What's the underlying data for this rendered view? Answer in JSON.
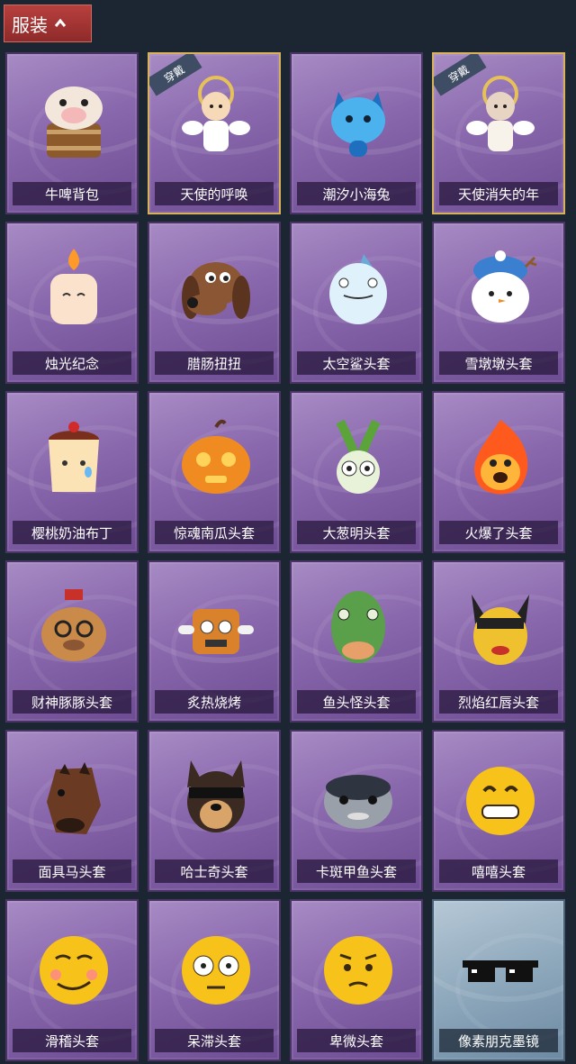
{
  "header": {
    "title": "服装",
    "toggle_icon": "chevron-up-icon"
  },
  "equipped_badge": "穿戴",
  "items": [
    {
      "name": "牛啤背包",
      "art": "cow-barrel",
      "equipped": false,
      "theme": "purple",
      "colors": [
        "#f3e7dc",
        "#8c5a2b"
      ]
    },
    {
      "name": "天使的呼唤",
      "art": "angel-boy",
      "equipped": true,
      "theme": "purple",
      "colors": [
        "#f6d9b6",
        "#e6c15a"
      ]
    },
    {
      "name": "潮汐小海兔",
      "art": "blue-rabbit",
      "equipped": false,
      "theme": "purple",
      "colors": [
        "#4cb2ee",
        "#1f6fbf"
      ]
    },
    {
      "name": "天使消失的年",
      "art": "angel-girl",
      "equipped": true,
      "theme": "purple",
      "colors": [
        "#e8d4c2",
        "#f7f2ea"
      ]
    },
    {
      "name": "烛光纪念",
      "art": "candle",
      "equipped": false,
      "theme": "purple",
      "colors": [
        "#fbe2cc",
        "#ff9a2a"
      ]
    },
    {
      "name": "腊肠扭扭",
      "art": "dog-brown",
      "equipped": false,
      "theme": "purple",
      "colors": [
        "#8a5634",
        "#5b3420"
      ]
    },
    {
      "name": "太空鲨头套",
      "art": "shark",
      "equipped": false,
      "theme": "purple",
      "colors": [
        "#dff1fb",
        "#6aa9d8"
      ]
    },
    {
      "name": "雪墩墩头套",
      "art": "snowman",
      "equipped": false,
      "theme": "purple",
      "colors": [
        "#ffffff",
        "#3a7fd0"
      ]
    },
    {
      "name": "樱桃奶油布丁",
      "art": "pudding",
      "equipped": false,
      "theme": "purple",
      "colors": [
        "#fbe3b5",
        "#7a2e1c"
      ]
    },
    {
      "name": "惊魂南瓜头套",
      "art": "pumpkin",
      "equipped": false,
      "theme": "purple",
      "colors": [
        "#f08b22",
        "#ffd35a"
      ]
    },
    {
      "name": "大葱明头套",
      "art": "scallion",
      "equipped": false,
      "theme": "purple",
      "colors": [
        "#e8f2d8",
        "#5aa43a"
      ]
    },
    {
      "name": "火爆了头套",
      "art": "fire",
      "equipped": false,
      "theme": "purple",
      "colors": [
        "#ff5a1e",
        "#ffb43a"
      ]
    },
    {
      "name": "财神豚豚头套",
      "art": "capybara",
      "equipped": false,
      "theme": "purple",
      "colors": [
        "#c98a4a",
        "#c8302a"
      ]
    },
    {
      "name": "炙热烧烤",
      "art": "bbq",
      "equipped": false,
      "theme": "purple",
      "colors": [
        "#d9822b",
        "#f2f2f2"
      ]
    },
    {
      "name": "鱼头怪头套",
      "art": "fish-man",
      "equipped": false,
      "theme": "purple",
      "colors": [
        "#5aa04a",
        "#e7a06a"
      ]
    },
    {
      "name": "烈焰红唇头套",
      "art": "yellow-mouse",
      "equipped": false,
      "theme": "purple",
      "colors": [
        "#f0c12e",
        "#222222"
      ]
    },
    {
      "name": "面具马头套",
      "art": "horse",
      "equipped": false,
      "theme": "purple",
      "colors": [
        "#6b3a22",
        "#2a1a12"
      ]
    },
    {
      "name": "哈士奇头套",
      "art": "husky",
      "equipped": false,
      "theme": "purple",
      "colors": [
        "#3a2a22",
        "#d9a46a"
      ]
    },
    {
      "name": "卡斑甲鱼头套",
      "art": "fish-gray",
      "equipped": false,
      "theme": "purple",
      "colors": [
        "#9aa0aa",
        "#2e3440"
      ]
    },
    {
      "name": "嘻嘻头套",
      "art": "grin",
      "equipped": false,
      "theme": "purple",
      "colors": [
        "#f7c21a",
        "#3a2a12"
      ]
    },
    {
      "name": "滑稽头套",
      "art": "smirk",
      "equipped": false,
      "theme": "purple",
      "colors": [
        "#f7c21a",
        "#ff7aa2"
      ]
    },
    {
      "name": "呆滞头套",
      "art": "stare",
      "equipped": false,
      "theme": "purple",
      "colors": [
        "#f7c21a",
        "#ffffff"
      ]
    },
    {
      "name": "卑微头套",
      "art": "shy",
      "equipped": false,
      "theme": "purple",
      "colors": [
        "#f7c21a",
        "#3a2a12"
      ]
    },
    {
      "name": "像素朋克墨镜",
      "art": "pixel-glasses",
      "equipped": false,
      "theme": "blue",
      "colors": [
        "#111111",
        "#ffffff"
      ]
    }
  ]
}
